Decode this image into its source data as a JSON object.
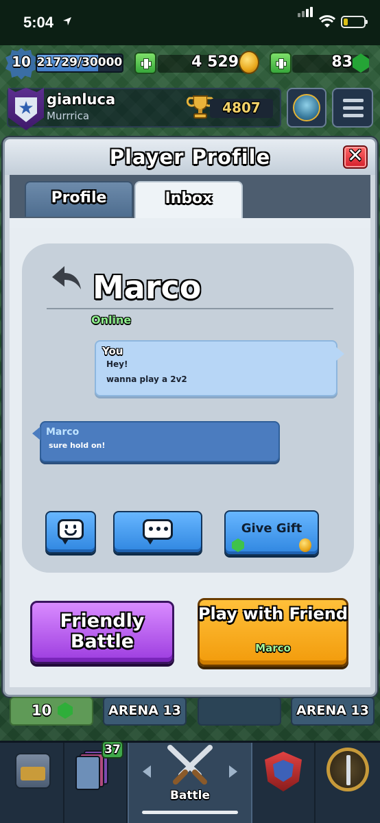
{
  "status_bar": {
    "time": "5:04"
  },
  "resources": {
    "level": "10",
    "xp": "21729/30000",
    "xp_progress": 0.72,
    "gold": "4 529",
    "gems": "83"
  },
  "player": {
    "name": "gianluca",
    "clan": "Murrrica",
    "trophies": "4807"
  },
  "modal": {
    "title": "Player Profile",
    "tabs": [
      {
        "label": "Profile",
        "active": false
      },
      {
        "label": "Inbox",
        "active": true
      }
    ]
  },
  "conversation": {
    "contact_name": "Marco",
    "contact_status": "Online",
    "messages": [
      {
        "sender": "You",
        "lines": [
          "Hey!",
          "wanna play a 2v2"
        ]
      },
      {
        "sender": "Marco",
        "lines": [
          "sure hold on!"
        ]
      }
    ]
  },
  "actions": {
    "give_gift": "Give Gift",
    "friendly_battle": "Friendly Battle",
    "play_with_friend": "Play with Friend",
    "play_with_friend_name": "Marco"
  },
  "arena_strip": {
    "gem_count": "10",
    "arena_1": "ARENA 13",
    "arena_3": "ARENA 13"
  },
  "bottom_nav": {
    "cards_badge": "37",
    "battle_label": "Battle"
  },
  "colors": {
    "accent_blue": "#2f86e0",
    "friendly_purple": "#9c3cdf",
    "play_orange": "#f29b0b",
    "online_green": "#8ff08d",
    "close_red": "#d41f2b"
  },
  "icons": [
    "location-icon",
    "signal-icon",
    "wifi-icon",
    "battery-icon",
    "gold-coin-icon",
    "gem-icon",
    "trophy-icon",
    "league-icon",
    "menu-icon",
    "close-icon",
    "back-icon",
    "emote-icon",
    "chat-icon",
    "shop-icon",
    "cards-icon",
    "battle-icon",
    "clan-nav-icon",
    "tournament-icon"
  ]
}
